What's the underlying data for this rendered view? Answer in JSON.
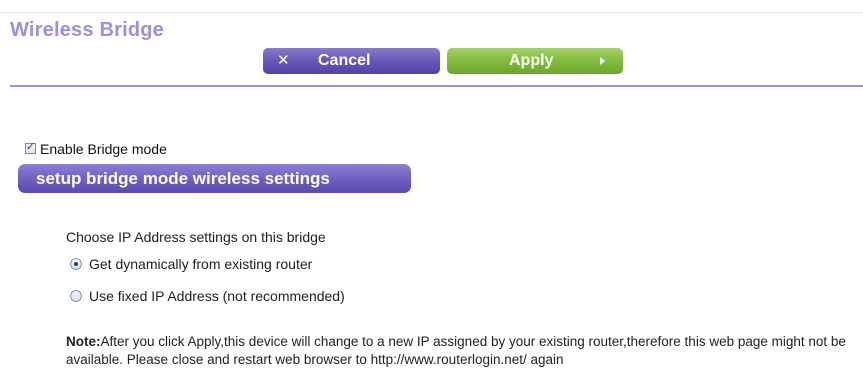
{
  "page": {
    "title": "Wireless Bridge"
  },
  "toolbar": {
    "cancel_label": "Cancel",
    "cancel_icon": "close-icon",
    "apply_label": "Apply",
    "apply_icon": "arrow-right-icon"
  },
  "bridge": {
    "enable_label": "Enable Bridge mode",
    "enable_checked": true,
    "setup_button_label": "setup bridge mode wireless settings"
  },
  "ip_settings": {
    "heading": "Choose IP Address settings on this bridge",
    "options": [
      {
        "label": "Get dynamically from existing router",
        "selected": true
      },
      {
        "label": "Use fixed IP Address (not recommended)",
        "selected": false
      }
    ]
  },
  "note": {
    "prefix": "Note:",
    "text": "After you click Apply,this device will change to a new IP assigned by your existing router,therefore this web page might not be available. Please close and restart web browser to http://www.routerlogin.net/ again"
  },
  "colors": {
    "title": "#9b8fe2",
    "cancel_button": "#6a59b8",
    "apply_button": "#84bd3f",
    "rule": "#9a90dc"
  }
}
